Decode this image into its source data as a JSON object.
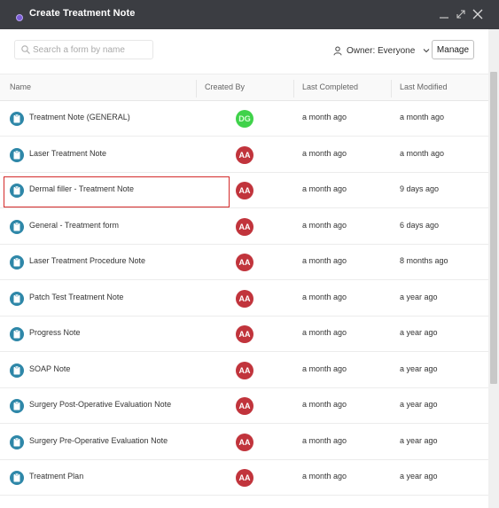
{
  "window": {
    "title": "Create Treatment Note"
  },
  "toolbar": {
    "search_placeholder": "Search a form by name",
    "owner_label": "Owner: Everyone",
    "manage_label": "Manage"
  },
  "table": {
    "columns": {
      "name": "Name",
      "created_by": "Created By",
      "last_completed": "Last Completed",
      "last_modified": "Last Modified"
    },
    "rows": [
      {
        "name": "Treatment Note (GENERAL)",
        "initials": "DG",
        "avatar_color": "#3fd24a",
        "last_completed": "a month ago",
        "last_modified": "a month ago"
      },
      {
        "name": "Laser Treatment Note",
        "initials": "AA",
        "avatar_color": "#c1343c",
        "last_completed": "a month ago",
        "last_modified": "a month ago"
      },
      {
        "name": "Dermal filler - Treatment Note",
        "initials": "AA",
        "avatar_color": "#c1343c",
        "last_completed": "a month ago",
        "last_modified": "9 days ago",
        "highlighted": true
      },
      {
        "name": "General - Treatment form",
        "initials": "AA",
        "avatar_color": "#c1343c",
        "last_completed": "a month ago",
        "last_modified": "6 days ago"
      },
      {
        "name": "Laser Treatment Procedure Note",
        "initials": "AA",
        "avatar_color": "#c1343c",
        "last_completed": "a month ago",
        "last_modified": "8 months ago"
      },
      {
        "name": "Patch Test Treatment Note",
        "initials": "AA",
        "avatar_color": "#c1343c",
        "last_completed": "a month ago",
        "last_modified": "a year ago"
      },
      {
        "name": "Progress Note",
        "initials": "AA",
        "avatar_color": "#c1343c",
        "last_completed": "a month ago",
        "last_modified": "a year ago"
      },
      {
        "name": "SOAP Note",
        "initials": "AA",
        "avatar_color": "#c1343c",
        "last_completed": "a month ago",
        "last_modified": "a year ago"
      },
      {
        "name": "Surgery Post-Operative Evaluation Note",
        "initials": "AA",
        "avatar_color": "#c1343c",
        "last_completed": "a month ago",
        "last_modified": "a year ago"
      },
      {
        "name": "Surgery Pre-Operative Evaluation Note",
        "initials": "AA",
        "avatar_color": "#c1343c",
        "last_completed": "a month ago",
        "last_modified": "a year ago"
      },
      {
        "name": "Treatment Plan",
        "initials": "AA",
        "avatar_color": "#c1343c",
        "last_completed": "a month ago",
        "last_modified": "a year ago"
      }
    ]
  },
  "colors": {
    "titlebar": "#3b3d42",
    "form_icon": "#2e87a8",
    "highlight": "#d42a2a"
  }
}
